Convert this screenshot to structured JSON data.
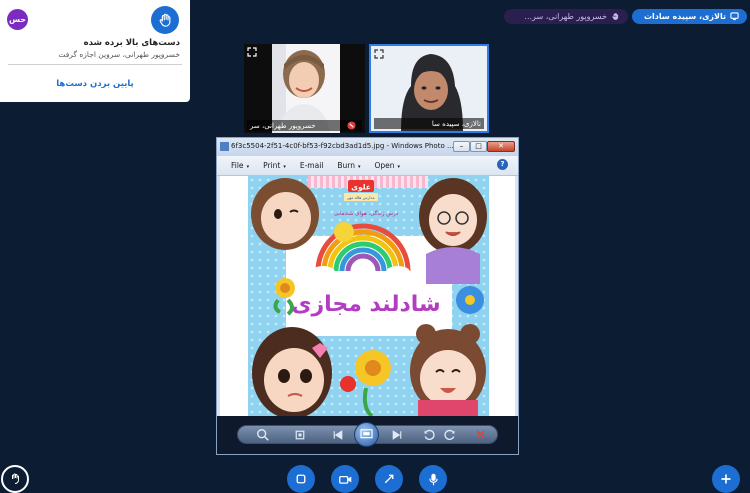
{
  "raised_hands_panel": {
    "avatar_initials": "حس",
    "title": "دست‌های بالا برده شده",
    "subtitle": "خسروپور طهرانی، سروین اجازه گرفت",
    "lower_hands_label": "پایین بردن دست‌ها"
  },
  "users_bar": {
    "presenter_name": "تالازی، سپیده سادات",
    "viewer_name": "خسروپور طهرانی، سر..."
  },
  "video_tiles": [
    {
      "label": "خسروپور طهرانی، سر"
    },
    {
      "label": "تالازی، سپیده سا"
    }
  ],
  "photo_viewer": {
    "window_title": "6f3c5504-2f51-4c0f-bf53-f92cbd3ad1d5.jpg - Windows Photo ...",
    "win_min": "–",
    "win_max": "□",
    "win_close": "✕",
    "menu": {
      "file": "File",
      "print": "Print",
      "email": "E-mail",
      "burn": "Burn",
      "open": "Open",
      "caret": "▾"
    },
    "help": "?",
    "image": {
      "brand": "علوی",
      "brand_sub": "مدارس هاله مهر",
      "tagline": "درس زندگی، هوای شادمانی",
      "title": "شادلند مجازی"
    }
  },
  "colors": {
    "background": "#0b1c33",
    "accent": "#1c6ed2",
    "avatar": "#7b2cbf"
  }
}
